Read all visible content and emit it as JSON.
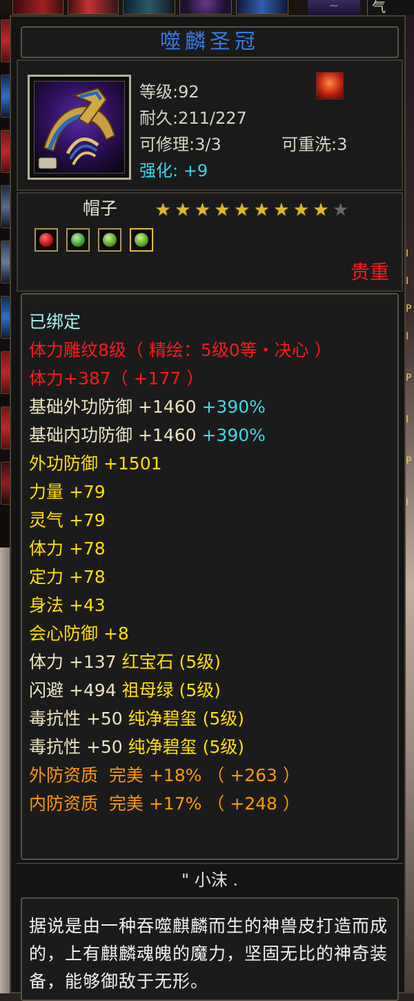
{
  "top_bar": {
    "qi_label": "气"
  },
  "item": {
    "name": "噬麟圣冠",
    "level": "等级:92",
    "durability": "耐久:211/227",
    "repairable": "可修理:3/3",
    "rewashable": "可重洗:3",
    "enhance": "强化: +9",
    "type": "帽子",
    "rarity": "贵重",
    "stars": {
      "filled": 9,
      "total": 10
    },
    "gems": [
      "ruby",
      "emerald",
      "jade",
      "jade"
    ],
    "icon": "crown-helmet-icon",
    "badge_icon": "flame-badge-icon"
  },
  "attributes": [
    {
      "text": "已绑定",
      "color": "cyan"
    },
    {
      "text": "体力雕纹8级（ 精绘：5级0等・决心 ）",
      "color": "red"
    },
    {
      "text": "体力+387（ +177 ）",
      "color": "red"
    },
    {
      "text": "基础外功防御 +1460",
      "color": "beige",
      "extra": " +390%",
      "extra_color": "teal"
    },
    {
      "text": "基础内功防御 +1460",
      "color": "beige",
      "extra": " +390%",
      "extra_color": "teal"
    },
    {
      "text": "外功防御 +1501",
      "color": "yellow"
    },
    {
      "text": "力量 +79",
      "color": "yellow"
    },
    {
      "text": "灵气 +79",
      "color": "yellow"
    },
    {
      "text": "体力 +78",
      "color": "yellow"
    },
    {
      "text": "定力 +78",
      "color": "yellow"
    },
    {
      "text": "身法 +43",
      "color": "yellow"
    },
    {
      "text": "会心防御 +8",
      "color": "yellow"
    },
    {
      "text": "体力 +137 ",
      "color": "beige",
      "extra": "红宝石 (5级)",
      "extra_color": "yellow"
    },
    {
      "text": "闪避 +494 ",
      "color": "beige",
      "extra": "祖母绿 (5级)",
      "extra_color": "yellow"
    },
    {
      "text": "毒抗性 +50 ",
      "color": "beige",
      "extra": "纯净碧玺 (5级)",
      "extra_color": "yellow"
    },
    {
      "text": "毒抗性 +50 ",
      "color": "beige",
      "extra": "纯净碧玺 (5级)",
      "extra_color": "yellow"
    },
    {
      "text": "外防资质  完美 +18% （ +263 ）",
      "color": "orange"
    },
    {
      "text": "内防资质  完美 +17% （ +248 ）",
      "color": "orange"
    }
  ],
  "owner": "\" 小沫 .",
  "description": "据说是由一种吞噬麒麟而生的神兽皮打造而成的，上有麒麟魂魄的魔力，坚固无比的神奇装备，能够御敌于无形。",
  "colors": {
    "title": "#3a78e0",
    "rarity": "#ff1a1a",
    "enhance": "#38d8e8"
  }
}
